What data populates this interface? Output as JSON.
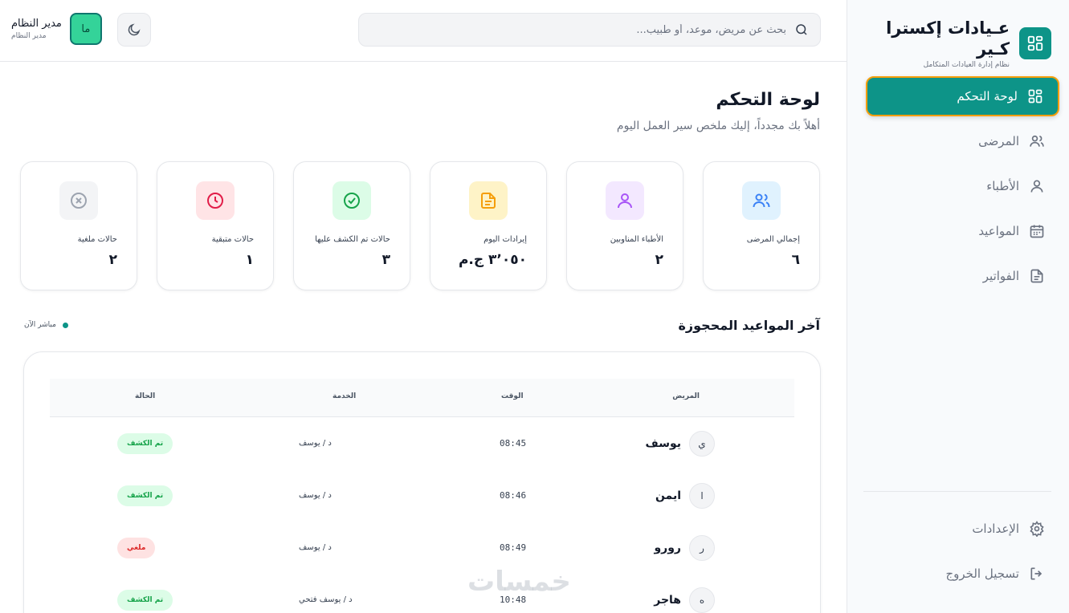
{
  "brand": {
    "title": "عـيادات إكسترا كـير",
    "subtitle": "نظام إدارة العيادات المتكامل"
  },
  "sidebar": {
    "items": [
      {
        "label": "لوحة التحكم",
        "icon": "dashboard-icon",
        "active": true
      },
      {
        "label": "المرضى",
        "icon": "users-icon"
      },
      {
        "label": "الأطباء",
        "icon": "user-icon"
      },
      {
        "label": "المواعيد",
        "icon": "calendar-icon"
      },
      {
        "label": "الفواتير",
        "icon": "document-icon"
      }
    ],
    "bottom": [
      {
        "label": "الإعدادات",
        "icon": "gear-icon"
      },
      {
        "label": "تسجيل الخروج",
        "icon": "logout-icon"
      }
    ]
  },
  "header": {
    "search_placeholder": "بحث عن مريض، موعد، أو طبيب...",
    "user": {
      "name": "مدير النظام",
      "role": "مدير النظام",
      "initials": "ما"
    }
  },
  "page": {
    "title": "لوحة التحكم",
    "subtitle": "أهلاً بك مجدداً، إليك ملخص سير العمل اليوم"
  },
  "stats": [
    {
      "label": "إجمالي المرضى",
      "value": "٦",
      "icon": "users-icon",
      "color": "#3b82f6",
      "bg": "#e0f2fe"
    },
    {
      "label": "الأطباء المناوبين",
      "value": "٢",
      "icon": "user-icon",
      "color": "#a855f7",
      "bg": "#f3e8ff"
    },
    {
      "label": "إيرادات اليوم",
      "value": "٣٬٠٥٠ ج.م",
      "icon": "document-icon",
      "color": "#f59e0b",
      "bg": "#fef3c7"
    },
    {
      "label": "حالات تم الكشف عليها",
      "value": "٣",
      "icon": "check-circle-icon",
      "color": "#16a34a",
      "bg": "#dcfce7"
    },
    {
      "label": "حالات متبقية",
      "value": "١",
      "icon": "clock-icon",
      "color": "#e11d48",
      "bg": "#ffe4e6"
    },
    {
      "label": "حالات ملغية",
      "value": "٢",
      "icon": "x-circle-icon",
      "color": "#9ca3af",
      "bg": "#f3f4f6"
    }
  ],
  "appointments": {
    "title": "آخر المواعيد المحجوزة",
    "live_label": "مباشر الآن",
    "columns": {
      "patient": "المريض",
      "time": "الوقت",
      "service": "الخدمة",
      "status": "الحالة"
    },
    "rows": [
      {
        "initial": "ي",
        "patient": "يوسف",
        "time": "08:45",
        "service": "د / يوسف",
        "status": "تم الكشف",
        "status_type": "ok"
      },
      {
        "initial": "ا",
        "patient": "ايمن",
        "time": "08:46",
        "service": "د / يوسف",
        "status": "تم الكشف",
        "status_type": "ok"
      },
      {
        "initial": "ر",
        "patient": "رورو",
        "time": "08:49",
        "service": "د / يوسف",
        "status": "ملغي",
        "status_type": "cancel"
      },
      {
        "initial": "ه",
        "patient": "هاجر",
        "time": "10:48",
        "service": "د / يوسف فتحي",
        "status": "تم الكشف",
        "status_type": "ok"
      }
    ]
  },
  "watermark": "خمسات",
  "colors": {
    "primary": "#0d9488",
    "active_border": "#f59e0b"
  }
}
